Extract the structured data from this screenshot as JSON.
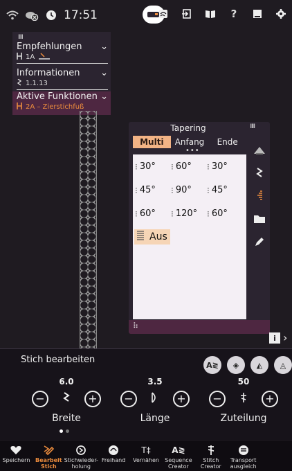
{
  "status": {
    "time": "17:51",
    "icons_left": [
      "wifi-icon",
      "cloud-off-icon",
      "clock-icon"
    ],
    "icons_right": [
      "cast-icon",
      "import-icon",
      "book-icon",
      "help-icon",
      "notebook-icon",
      "settings-icon"
    ]
  },
  "info_panel": {
    "recommendations_title": "Empfehlungen",
    "recommendations_sub": "1A",
    "information_title": "Informationen",
    "information_sub": "1.1.13",
    "active_functions_title": "Aktive Funktionen",
    "active_functions_sub": "2A – Zierstichfuß"
  },
  "tapering": {
    "title": "Tapering",
    "tabs": [
      "Multi",
      "Anfang",
      "Ende"
    ],
    "selected_tab": "Multi",
    "rows": [
      [
        "30°",
        "60°",
        "30°"
      ],
      [
        "45°",
        "90°",
        "45°"
      ],
      [
        "60°",
        "120°",
        "60°"
      ]
    ],
    "off_label": "Aus"
  },
  "edit": {
    "title": "Stich bearbeiten",
    "width_value": "6.0",
    "width_label": "Breite",
    "length_value": "3.5",
    "length_label": "Länge",
    "spacing_value": "50",
    "spacing_label": "Zuteilung"
  },
  "nav": [
    {
      "label": "Speichern",
      "icon": "heart-icon"
    },
    {
      "label": "Bearbeit Stich",
      "icon": "edit-stitch-icon",
      "selected": true
    },
    {
      "label": "Stichwieder-holung",
      "icon": "repeat-icon"
    },
    {
      "label": "Freihand",
      "icon": "freehand-icon"
    },
    {
      "label": "Vernähen",
      "icon": "tie-off-icon"
    },
    {
      "label": "Sequence Creator",
      "icon": "sequence-icon"
    },
    {
      "label": "Stitch Creator",
      "icon": "stitch-creator-icon"
    },
    {
      "label": "Transport ausgleich",
      "icon": "transport-icon"
    }
  ],
  "colors": {
    "accent": "#ec8c3d",
    "selected_tab": "#f2b385",
    "panel_active": "#4e2741"
  }
}
